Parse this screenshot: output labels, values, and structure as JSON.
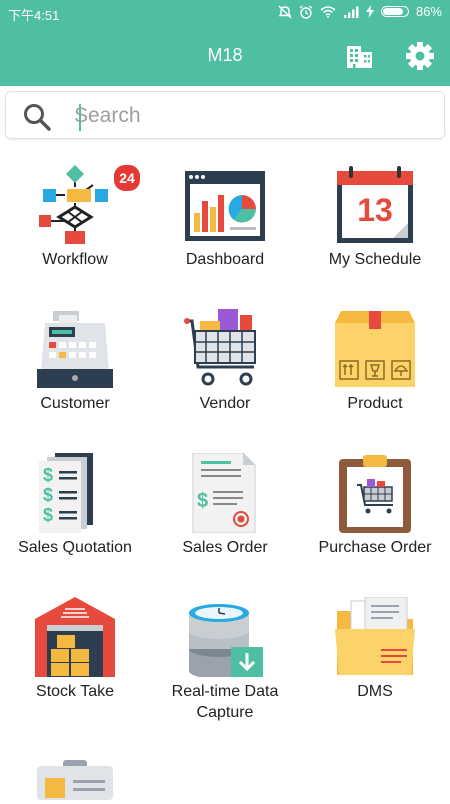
{
  "status_bar": {
    "time": "下午4:51",
    "battery": "86%",
    "battery_level": 0.86
  },
  "app_bar": {
    "title": "M18"
  },
  "search": {
    "placeholder": "Search"
  },
  "modules": [
    {
      "label": "Workflow",
      "badge": "24"
    },
    {
      "label": "Dashboard"
    },
    {
      "label": "My Schedule",
      "calendar_day": "13"
    },
    {
      "label": "Customer"
    },
    {
      "label": "Vendor"
    },
    {
      "label": "Product"
    },
    {
      "label": "Sales Quotation"
    },
    {
      "label": "Sales Order"
    },
    {
      "label": "Purchase Order"
    },
    {
      "label": "Stock Take"
    },
    {
      "label": "Real-time Data Capture"
    },
    {
      "label": "DMS"
    },
    {
      "label": ""
    }
  ],
  "colors": {
    "accent": "#4fbfa3",
    "badge": "#e53935"
  }
}
